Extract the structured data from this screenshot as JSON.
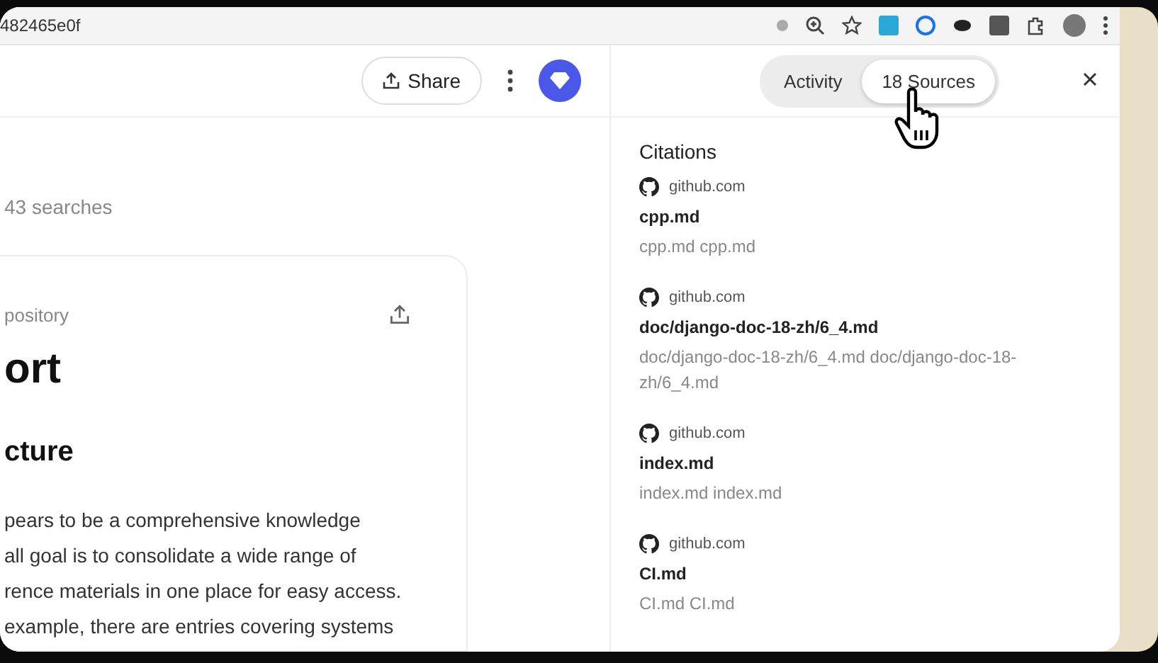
{
  "browser": {
    "url": "482465e0f"
  },
  "header": {
    "share_label": "Share"
  },
  "panel_tabs": [
    {
      "label": "Activity",
      "selected": false
    },
    {
      "label": "18 Sources",
      "selected": true
    }
  ],
  "main": {
    "searches": "43 searches",
    "card": {
      "eyebrow": "pository",
      "title": "ort",
      "heading": "cture",
      "lines": [
        "pears to be a comprehensive knowledge",
        "all goal is to consolidate a wide range of",
        "rence materials in one place for easy access.",
        "example, there are entries covering systems"
      ]
    }
  },
  "citations": {
    "title": "Citations",
    "items": [
      {
        "site": "github.com",
        "name": "cpp.md",
        "snippet": "cpp.md cpp.md"
      },
      {
        "site": "github.com",
        "name": "doc/django-doc-18-zh/6_4.md",
        "snippet": "doc/django-doc-18-zh/6_4.md doc/django-doc-18-zh/6_4.md"
      },
      {
        "site": "github.com",
        "name": "index.md",
        "snippet": "index.md index.md"
      },
      {
        "site": "github.com",
        "name": "CI.md",
        "snippet": "CI.md CI.md"
      }
    ]
  }
}
